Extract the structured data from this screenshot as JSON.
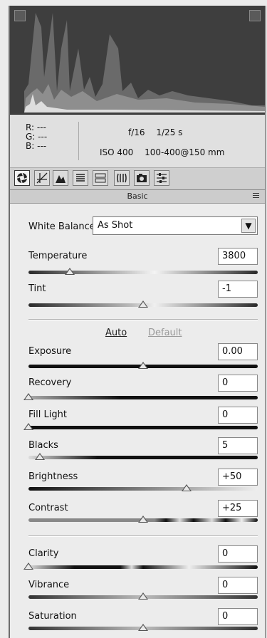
{
  "camera": {
    "r_label": "R:",
    "r_value": "---",
    "g_label": "G:",
    "g_value": "---",
    "b_label": "B:",
    "b_value": "---",
    "aperture": "f/16",
    "shutter": "1/25 s",
    "iso": "ISO 400",
    "lens": "100-400@150 mm"
  },
  "tabs": [
    {
      "icon": "aperture-icon",
      "active": true
    },
    {
      "icon": "tone-curve-icon"
    },
    {
      "icon": "detail-icon"
    },
    {
      "icon": "hsl-icon"
    },
    {
      "icon": "split-toning-icon"
    },
    {
      "icon": "lens-corrections-icon"
    },
    {
      "icon": "camera-calibration-icon"
    },
    {
      "icon": "presets-icon"
    }
  ],
  "panel": {
    "title": "Basic"
  },
  "white_balance": {
    "label": "White Balance:",
    "value": "As Shot"
  },
  "sliders": {
    "temperature": {
      "label": "Temperature",
      "value": "3800",
      "position": 0.18
    },
    "tint": {
      "label": "Tint",
      "value": "-1",
      "position": 0.5
    },
    "exposure": {
      "label": "Exposure",
      "value": "0.00",
      "position": 0.5
    },
    "recovery": {
      "label": "Recovery",
      "value": "0",
      "position": 0.0
    },
    "fill_light": {
      "label": "Fill Light",
      "value": "0",
      "position": 0.0
    },
    "blacks": {
      "label": "Blacks",
      "value": "5",
      "position": 0.05
    },
    "brightness": {
      "label": "Brightness",
      "value": "+50",
      "position": 0.69
    },
    "contrast": {
      "label": "Contrast",
      "value": "+25",
      "position": 0.5
    },
    "clarity": {
      "label": "Clarity",
      "value": "0",
      "position": 0.0
    },
    "vibrance": {
      "label": "Vibrance",
      "value": "0",
      "position": 0.5
    },
    "saturation": {
      "label": "Saturation",
      "value": "0",
      "position": 0.5
    }
  },
  "links": {
    "auto": "Auto",
    "default": "Default"
  }
}
